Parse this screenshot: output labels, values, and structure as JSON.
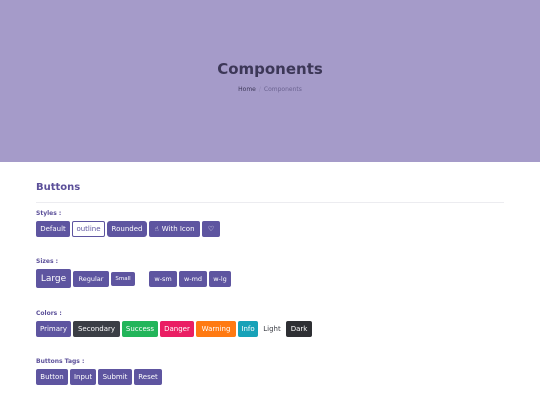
{
  "header": {
    "title": "Components",
    "breadcrumb": {
      "home": "Home",
      "separator": "/",
      "current": "Components"
    }
  },
  "buttons_section": {
    "title": "Buttons",
    "styles": {
      "label": "Styles :",
      "default": "Default",
      "outline": "outline",
      "rounded": "Rounded",
      "with_icon": "With Icon",
      "thumb_icon": "thumbs-up-icon",
      "heart_icon": "heart-icon"
    },
    "sizes": {
      "label": "Sizes :",
      "large": "Large",
      "regular": "Regular",
      "small": "Small",
      "w_sm": "w-sm",
      "w_md": "w-md",
      "w_lg": "w-lg"
    },
    "colors": {
      "label": "Colors :",
      "primary": "Primary",
      "secondary": "Secondary",
      "success": "Success",
      "danger": "Danger",
      "warning": "Warning",
      "info": "Info",
      "light": "Light",
      "dark": "Dark"
    },
    "tags": {
      "label": "Buttons Tags :",
      "button": "Button",
      "input": "Input",
      "submit": "Submit",
      "reset": "Reset"
    }
  },
  "colors": {
    "hero": "#a59bc9",
    "primary": "#5e55a0",
    "success": "#22b55a",
    "danger": "#ea1e63",
    "warning": "#ff7a12",
    "info": "#17a2b8",
    "dark": "#2e2f33"
  }
}
